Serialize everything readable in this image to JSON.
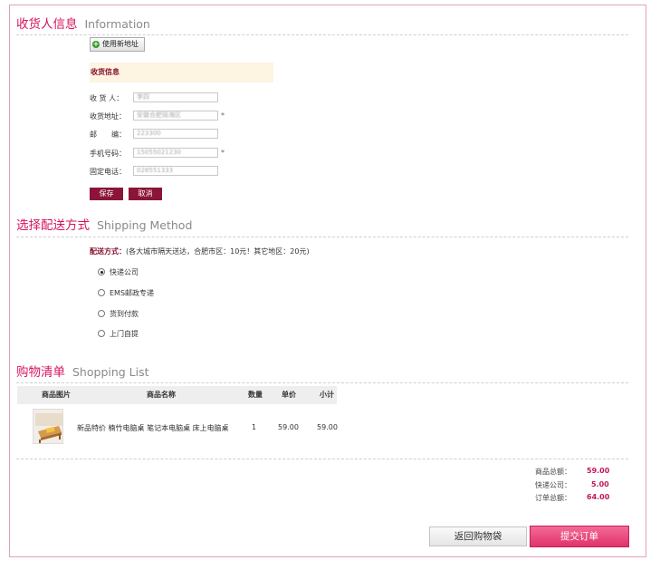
{
  "receiver_section": {
    "title": "收货人信息",
    "subtitle": "Information",
    "new_address_button": "使用新地址",
    "form_heading": "收货信息",
    "fields": [
      {
        "label": "收 货 人：",
        "value": "李四",
        "required": false
      },
      {
        "label": "收货地址：",
        "value": "安徽合肥瑶海区",
        "required": true
      },
      {
        "label": "邮　　编：",
        "value": "223300",
        "required": false
      },
      {
        "label": "手机号码：",
        "value": "15055021230",
        "required": true
      },
      {
        "label": "固定电话：",
        "value": "028551333",
        "required": false
      }
    ],
    "required_mark": "*",
    "save_button": "保存",
    "cancel_button": "取消"
  },
  "shipping_section": {
    "title": "选择配送方式",
    "subtitle": "Shipping Method",
    "label": "配送方式：",
    "note": "(各大城市隔天送达，合肥市区：10元！其它地区：20元)",
    "options": [
      {
        "label": "快递公司",
        "selected": true
      },
      {
        "label": "EMS邮政专递",
        "selected": false
      },
      {
        "label": "货到付款",
        "selected": false
      },
      {
        "label": "上门自提",
        "selected": false
      }
    ]
  },
  "shopping_section": {
    "title": "购物清单",
    "subtitle": "Shopping List",
    "columns": [
      "商品图片",
      "商品名称",
      "数量",
      "单价",
      "小计"
    ],
    "rows": [
      {
        "name": "新品特价 楠竹电脑桌 笔记本电脑桌 床上电脑桌",
        "qty": "1",
        "price": "59.00",
        "subtotal": "59.00"
      }
    ]
  },
  "summary": {
    "items": [
      {
        "label": "商品总额：",
        "value": "59.00"
      },
      {
        "label": "快递公司：",
        "value": "5.00"
      },
      {
        "label": "订单总额：",
        "value": "64.00"
      }
    ]
  },
  "actions": {
    "back_button": "返回购物袋",
    "submit_button": "提交订单"
  },
  "colors": {
    "accent": "#d7135e",
    "dark_button": "#8a1538",
    "submit": "#e1336b",
    "form_bg": "#fdf5e1",
    "border": "#e3a0bc"
  }
}
